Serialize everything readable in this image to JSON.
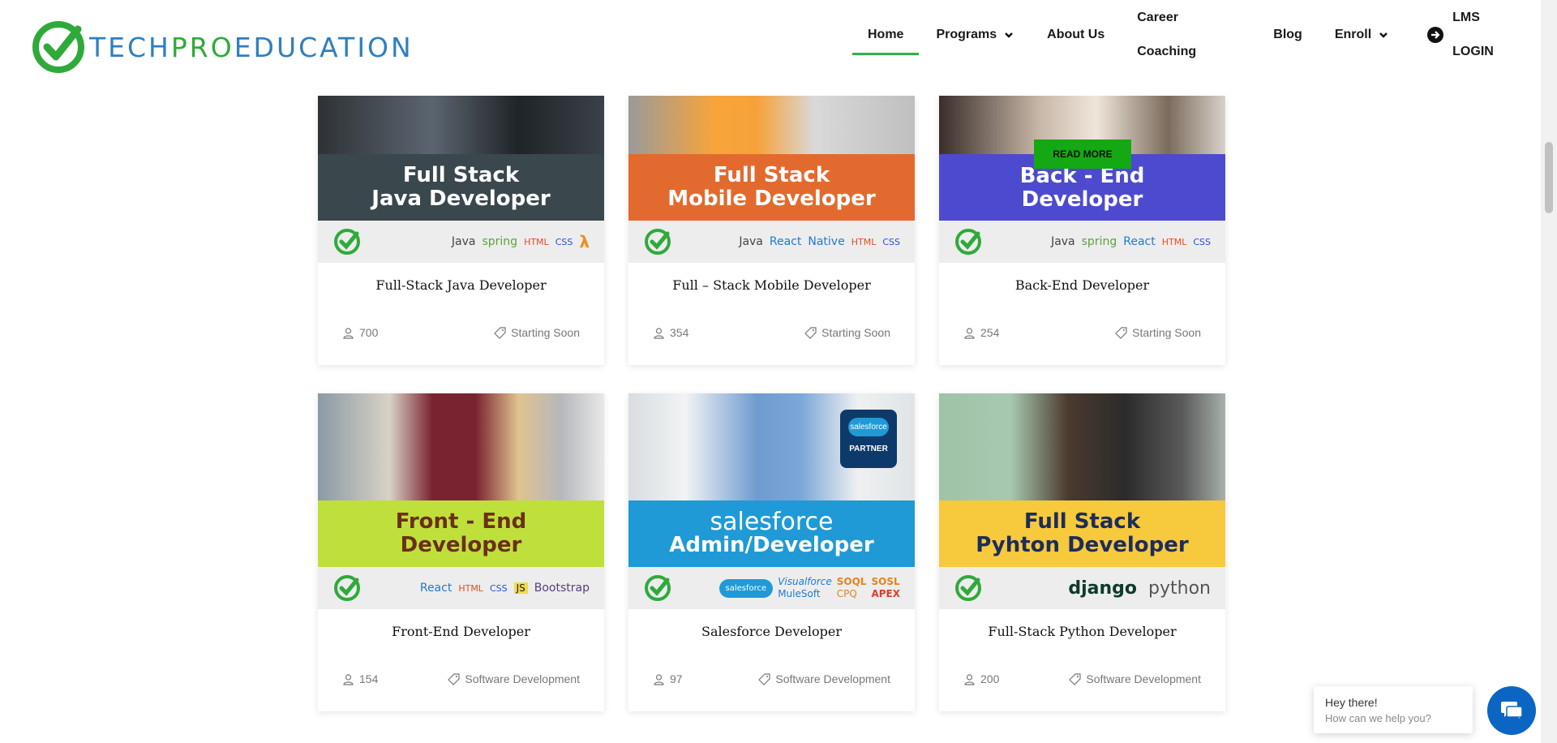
{
  "brand": {
    "part1": "TECH",
    "part2": "PRO",
    "part3": "EDUCATION",
    "green": "#2faa3a",
    "blue": "#2f7fc1"
  },
  "nav": {
    "items": [
      {
        "label": "Home"
      },
      {
        "label": "Programs"
      },
      {
        "label": "About Us"
      },
      {
        "label": "Career Coaching"
      },
      {
        "label": "Blog"
      },
      {
        "label": "Enroll"
      }
    ],
    "lms_label": "LMS LOGIN"
  },
  "read_more": "READ MORE",
  "cards": [
    {
      "banner": [
        "Full Stack",
        "Java Developer"
      ],
      "band_color": "#3a474d",
      "tech": [
        "Java",
        "spring",
        "HTML",
        "CSS",
        "λ"
      ],
      "title": "Full-Stack Java Developer",
      "students": "700",
      "tag": "Starting Soon"
    },
    {
      "banner": [
        "Full Stack",
        "Mobile Developer"
      ],
      "band_color": "#e36a2e",
      "tech": [
        "Java",
        "React",
        "Native",
        "HTML",
        "CSS"
      ],
      "title": "Full – Stack Mobile Developer",
      "students": "354",
      "tag": "Starting Soon"
    },
    {
      "banner": [
        "Back - End",
        "Developer"
      ],
      "band_color": "#4d4ad0",
      "tech": [
        "Java",
        "spring",
        "React",
        "HTML",
        "CSS"
      ],
      "title": "Back-End Developer",
      "students": "254",
      "tag": "Starting Soon"
    },
    {
      "banner": [
        "Front - End",
        "Developer"
      ],
      "band_color": "#bfe03a",
      "tech": [
        "React",
        "HTML",
        "CSS",
        "JS",
        "Bootstrap"
      ],
      "title": "Front-End Developer",
      "students": "154",
      "tag": "Software Development"
    },
    {
      "banner": [
        "salesforce",
        "Admin/Developer"
      ],
      "band_color": "#1f9ad6",
      "tech": [
        "salesforce",
        "Visualforce",
        "SOQL",
        "SOSL",
        "MuleSoft",
        "CPQ",
        "APEX"
      ],
      "badge": [
        "salesforce",
        "PARTNER"
      ],
      "title": "Salesforce Developer",
      "students": "97",
      "tag": "Software Development"
    },
    {
      "banner": [
        "Full Stack",
        "Pyhton Developer"
      ],
      "band_color": "#f7c93c",
      "tech": [
        "django",
        "python"
      ],
      "title": "Full-Stack Python Developer",
      "students": "200",
      "tag": "Software Development"
    }
  ],
  "chat": {
    "line1": "Hey there!",
    "line2": "How can we help you?"
  }
}
